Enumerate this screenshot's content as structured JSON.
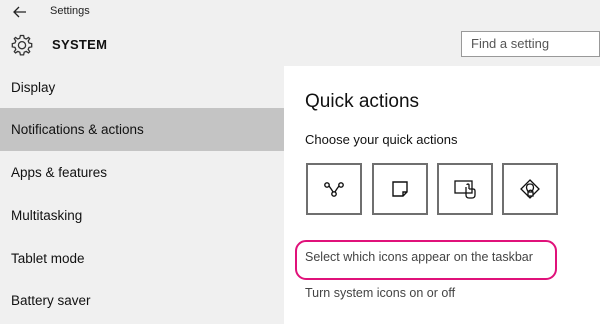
{
  "window": {
    "title": "Settings"
  },
  "header": {
    "section_title": "SYSTEM",
    "search_placeholder": "Find a setting"
  },
  "sidebar": {
    "items": [
      {
        "label": "Display",
        "active": false
      },
      {
        "label": "Notifications & actions",
        "active": true
      },
      {
        "label": "Apps & features",
        "active": false
      },
      {
        "label": "Multitasking",
        "active": false
      },
      {
        "label": "Tablet mode",
        "active": false
      },
      {
        "label": "Battery saver",
        "active": false
      }
    ]
  },
  "main": {
    "title": "Quick actions",
    "subtitle": "Choose your quick actions",
    "quick_actions": [
      {
        "icon": "connect-icon"
      },
      {
        "icon": "note-icon"
      },
      {
        "icon": "project-icon"
      },
      {
        "icon": "location-icon"
      }
    ],
    "link_taskbar_icons": "Select which icons appear on the taskbar",
    "link_system_icons": "Turn system icons on or off"
  },
  "colors": {
    "highlight": "#e0117a",
    "active_nav": "#c4c4c4",
    "sidebar_bg": "#f0f0f0",
    "link_text": "#444444"
  }
}
